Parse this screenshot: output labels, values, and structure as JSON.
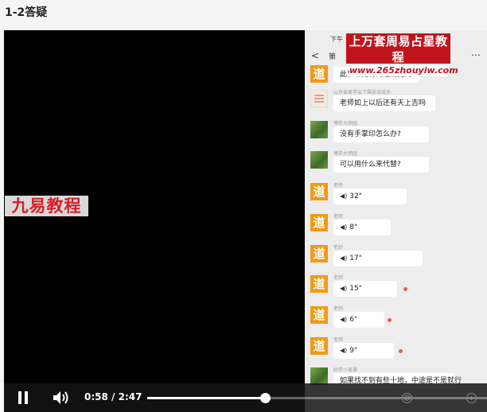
{
  "page": {
    "title": "1-2答疑"
  },
  "watermarks": {
    "left": "九易教程",
    "top_line1": "上万套周易占星教程",
    "top_line2": "www.265zhouyiw.com"
  },
  "phone": {
    "status_time": "下午",
    "nav_back": "<",
    "nav_title": "第",
    "nav_more": "⋯",
    "messages": [
      {
        "avatar": "dao",
        "sender": "",
        "text": "此节讲完有问题请提问",
        "voice": false
      },
      {
        "avatar": "doc",
        "sender": "山东省易学会下属协会成员",
        "text": "老师如上以后还有天上吉吗",
        "voice": false
      },
      {
        "avatar": "plant",
        "sender": "博弈大师园",
        "text": "没有手掌印怎么办?",
        "voice": false
      },
      {
        "avatar": "plant",
        "sender": "博弈大师园",
        "text": "可以用什么来代替?",
        "voice": false
      },
      {
        "avatar": "dao",
        "sender": "老师",
        "text": "32\"",
        "voice": true,
        "dot": false
      },
      {
        "avatar": "dao",
        "sender": "老师",
        "text": "8\"",
        "voice": true,
        "dot": false
      },
      {
        "avatar": "dao",
        "sender": "老师",
        "text": "17\"",
        "voice": true,
        "dot": false
      },
      {
        "avatar": "dao",
        "sender": "老师",
        "text": "15\"",
        "voice": true,
        "dot": true
      },
      {
        "avatar": "dao",
        "sender": "老师",
        "text": "6\"",
        "voice": true,
        "dot": true
      },
      {
        "avatar": "dao",
        "sender": "老师",
        "text": "9\"",
        "voice": true,
        "dot": true
      },
      {
        "avatar": "plant",
        "sender": "好学小易课",
        "text": "如果找不到有些十地，中途是不是就行",
        "voice": false
      }
    ],
    "voice_icon": "◀)"
  },
  "controls": {
    "current_time": "0:58",
    "separator": "/",
    "duration": "2:47",
    "progress_fraction": 0.347,
    "icon_right_1": "☺",
    "icon_right_2": "+"
  }
}
